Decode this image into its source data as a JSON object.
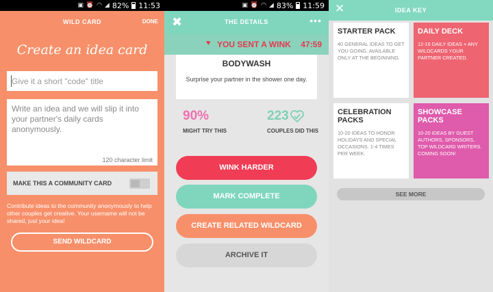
{
  "status": [
    {
      "battery": "82%",
      "time": "11:53"
    },
    {
      "battery": "83%",
      "time": "11:59"
    }
  ],
  "create": {
    "header_title": "WILD CARD",
    "done_label": "DONE",
    "hero": "Create an idea card",
    "title_placeholder": "Give it a short \"code\" title",
    "idea_placeholder": "Write an idea and we will slip it into your partner's daily cards anonymously.",
    "char_limit": "120 character limit",
    "community_label": "MAKE THIS A COMMUNITY CARD",
    "contrib_text": "Contribute ideas to the community anonymously to help other couples get creative. Your username will not be shared, just your idea!",
    "send_label": "SEND WILDCARD"
  },
  "details": {
    "header_title": "THE DETAILS",
    "banner_text": "YOU SENT A WINK",
    "timer": "47:59",
    "card_title": "BODYWASH",
    "card_body": "Surprise your partner in the shower one day.",
    "stat1_value": "90%",
    "stat1_label": "MIGHT TRY THIS",
    "stat2_value": "223",
    "stat2_label": "COUPLES DID THIS",
    "buttons": [
      "WINK HARDER",
      "MARK COMPLETE",
      "CREATE RELATED WILDCARD",
      "ARCHIVE IT"
    ]
  },
  "key": {
    "header_title": "IDEA KEY",
    "tiles": [
      {
        "title": "STARTER PACK",
        "desc": "40 GENERAL IDEAS TO GET YOU GOING. AVAILABLE ONLY AT THE BEGINNING."
      },
      {
        "title": "DAILY DECK",
        "desc": "12-16 DAILY IDEAS + ANY WILDCARDS YOUR PARTNER CREATED."
      },
      {
        "title": "CELEBRATION PACKS",
        "desc": "10-20 IDEAS TO HONOR HOLIDAYS AND SPECIAL OCCASIONS. 1-4 TIMES PER WEEK."
      },
      {
        "title": "SHOWCASE PACKS",
        "desc": "10-20 IDEAS BY GUEST AUTHORS, SPONSORS, TOP WILDCARD WRITERS. COMING SOON!"
      }
    ],
    "see_more": "SEE MORE"
  },
  "colors": {
    "orange": "#f7906a",
    "mint": "#7fd6bd",
    "red": "#f03c55",
    "coral": "#ee6471",
    "pink": "#df5bab"
  }
}
